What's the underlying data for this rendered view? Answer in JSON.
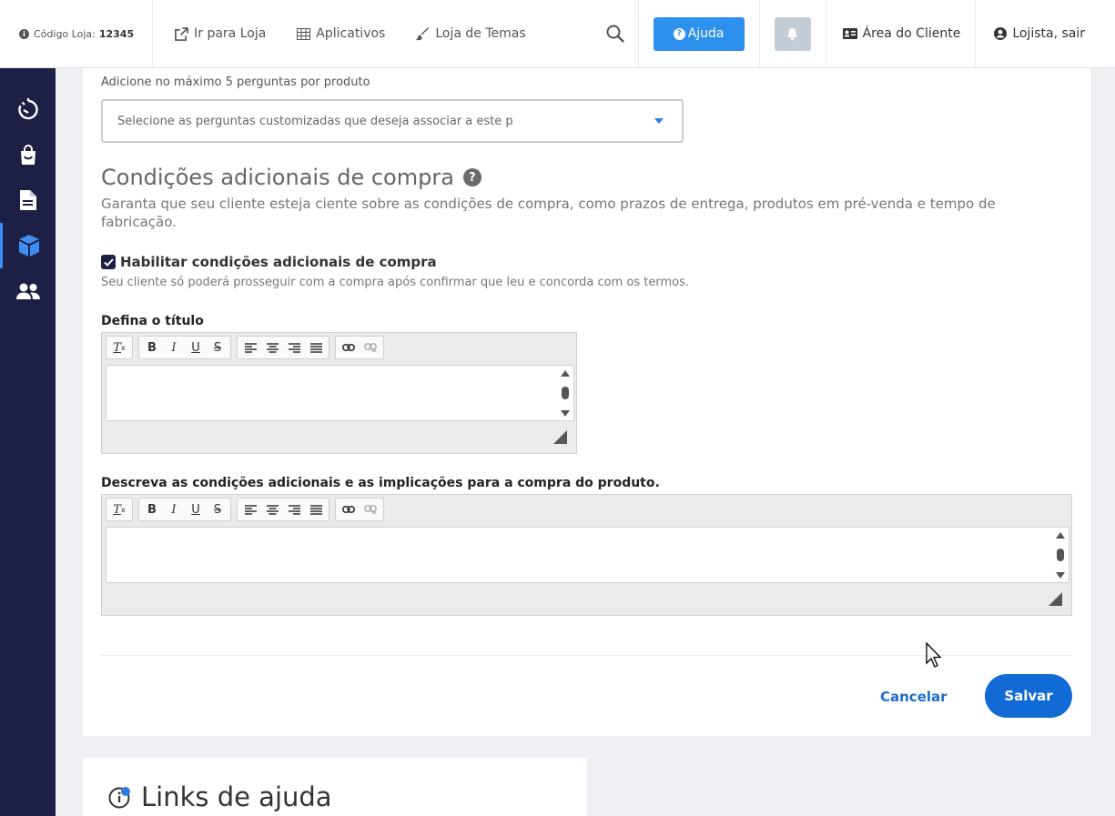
{
  "topbar": {
    "store_code_label": "Código Loja:",
    "store_code_value": "12345",
    "nav": [
      {
        "label": "Ir para Loja",
        "icon": "external-link-icon"
      },
      {
        "label": "Aplicativos",
        "icon": "grid-icon"
      },
      {
        "label": "Loja de Temas",
        "icon": "paintbrush-icon"
      }
    ],
    "help_label": "Ajuda",
    "client_area_label": "Área do Cliente",
    "logout_label": "Lojista, sair"
  },
  "sidebar": {
    "items": [
      {
        "icon": "dashboard-timer-icon"
      },
      {
        "icon": "shopping-bag-icon"
      },
      {
        "icon": "document-icon"
      },
      {
        "icon": "product-box-icon",
        "active": true
      },
      {
        "icon": "customers-icon"
      }
    ]
  },
  "form": {
    "questions_hint": "Adicione no máximo 5 perguntas por produto",
    "questions_placeholder": "Selecione as perguntas customizadas que deseja associar a este p",
    "section_title": "Condições adicionais de compra",
    "section_desc": "Garanta que seu cliente esteja ciente sobre as condições de compra, como prazos de entrega, produtos em pré-venda e tempo de fabricação.",
    "enable_label": "Habilitar condições adicionais de compra",
    "enable_checked": true,
    "enable_hint": "Seu cliente só poderá prosseguir com a compra após confirmar que leu e concorda com os termos.",
    "title_label": "Defina o título",
    "title_value": "",
    "desc_label": "Descreva as condições adicionais e as implicações para a compra do produto.",
    "desc_value": "",
    "cancel_label": "Cancelar",
    "save_label": "Salvar"
  },
  "help_links": {
    "title": "Links de ajuda"
  },
  "colors": {
    "sidebar_bg": "#1e1f45",
    "primary": "#116ad6",
    "help_button": "#2d90ec"
  }
}
